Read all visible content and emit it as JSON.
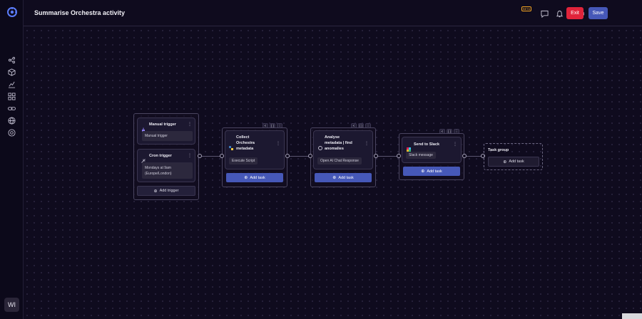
{
  "header": {
    "title": "Summarise Orchestra activity",
    "beta_badge": "BETA",
    "exit_label": "Exit",
    "save_label": "Save"
  },
  "sidebar": {
    "avatar_initials": "WI",
    "items": [
      "share-nodes-icon",
      "cube-icon",
      "chart-icon",
      "grid-icon",
      "link-icon",
      "globe-icon",
      "settings-circle-icon"
    ]
  },
  "triggers": {
    "manual": {
      "title": "Manual trigger",
      "value": "Manual trigger"
    },
    "cron": {
      "title": "Cron trigger",
      "value_line1": "Mondays at 9am",
      "value_line2": "(Europe/London)"
    },
    "add_trigger_label": "Add trigger"
  },
  "tasks": [
    {
      "title_lines": [
        "Collect",
        "Orchestra",
        "metadata"
      ],
      "pill": "Execute Script",
      "add_label": "Add task",
      "icon": "python-icon"
    },
    {
      "title_lines": [
        "Analyse",
        "metadata | find",
        "anomalies"
      ],
      "pill": "Open AI Chat Response",
      "add_label": "Add task",
      "icon": "openai-icon"
    },
    {
      "title_lines": [
        "Send to Slack"
      ],
      "pill": "Slack message",
      "add_label": "Add task",
      "icon": "slack-icon"
    }
  ],
  "task_group": {
    "label": "Task group",
    "add_label": "Add task"
  },
  "toolbar_glyphs": {
    "share": "<",
    "braces": "{ }",
    "more": "⋮"
  },
  "colors": {
    "accent": "#4658b8",
    "exit": "#e0243b",
    "background": "#0f0b1e"
  }
}
